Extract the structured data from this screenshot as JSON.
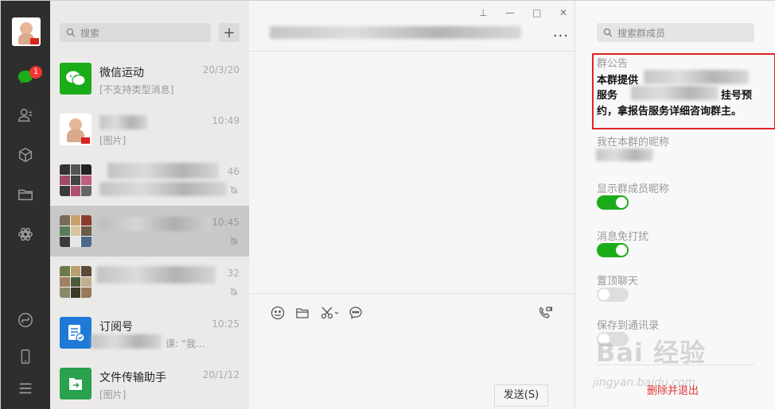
{
  "window_controls": {
    "pin": "⊥",
    "minimize": "—",
    "maximize": "□",
    "close": "✕"
  },
  "sidebar": {
    "unread_badge": "1",
    "icons": [
      "chat-icon",
      "contacts-icon",
      "favorites-icon",
      "files-icon",
      "moments-icon",
      "mini-program-icon",
      "phone-icon",
      "menu-icon"
    ]
  },
  "chat_list": {
    "search_placeholder": "搜索",
    "add_button": "+",
    "items": [
      {
        "name": "微信运动",
        "time": "20/3/20",
        "preview": "[不支持类型消息]"
      },
      {
        "name": "",
        "time": "10:49",
        "preview": "[图片]"
      },
      {
        "name": "",
        "time": "46",
        "preview": ""
      },
      {
        "name": "",
        "time": "10:45",
        "preview": ""
      },
      {
        "name": "",
        "time": "32",
        "preview": ""
      },
      {
        "name": "订阅号",
        "time": "10:25",
        "preview": "课: “我..."
      },
      {
        "name": "文件传输助手",
        "time": "20/1/12",
        "preview": "[图片]"
      }
    ]
  },
  "main": {
    "more_label": "···",
    "send_button": "发送(S)"
  },
  "group_panel": {
    "search_placeholder": "搜索群成员",
    "notice_label": "群公告",
    "notice_line1": "本群提供",
    "notice_line2_a": "服务",
    "notice_line2_b": "挂号预",
    "notice_line3": "约，拿报告服务详细咨询群主。",
    "nickname_label": "我在本群的昵称",
    "show_nickname_label": "显示群成员昵称",
    "show_nickname_on": true,
    "mute_label": "消息免打扰",
    "mute_on": true,
    "sticky_label": "置顶聊天",
    "sticky_on": false,
    "save_contacts_label": "保存到通讯录",
    "save_contacts_on": false,
    "exit_label": "删除并退出",
    "watermark": "Bai 经验",
    "watermark_sub": "jingyan.baidu.com"
  },
  "colors": {
    "accent_green": "#1aad19",
    "badge_red": "#f43530",
    "highlight_red": "#e02424"
  }
}
